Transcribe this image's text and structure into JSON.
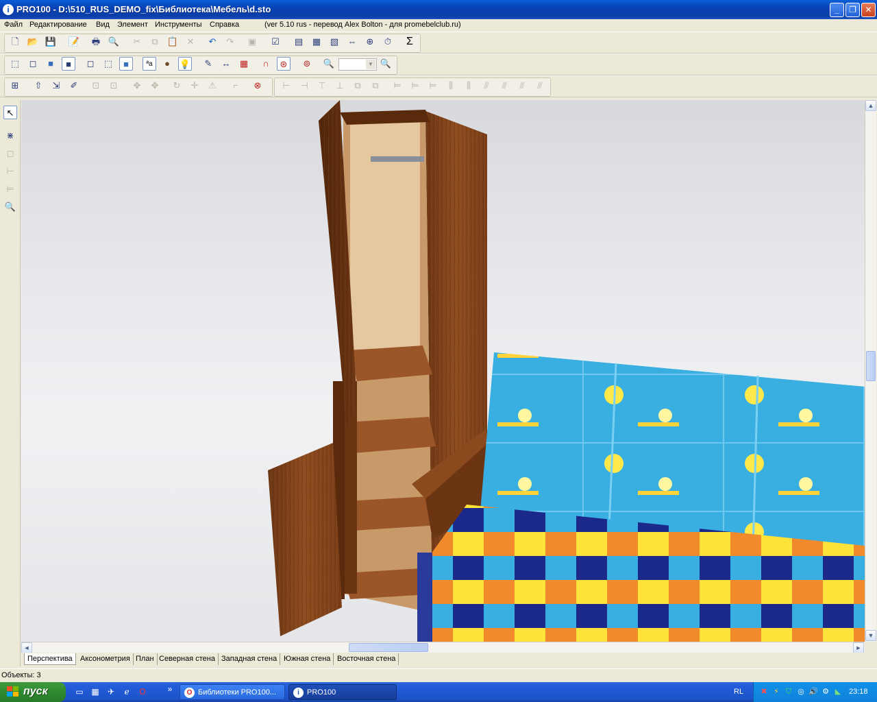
{
  "window": {
    "title": "PRO100 - D:\\510_RUS_DEMO_fix\\Библиотека\\Мебель\\d.sto",
    "app_icon": "PRO100-icon",
    "min_symbol": "_",
    "max_symbol": "❐",
    "close_symbol": "✕"
  },
  "menu": {
    "items": [
      "Файл",
      "Редактирование",
      "Вид",
      "Элемент",
      "Инструменты",
      "Справка"
    ],
    "version_note": "(ver 5.10 rus - перевод Alex Bolton - для promebelclub.ru)"
  },
  "toolbar1": {
    "icons": [
      "new-icon",
      "open-icon",
      "save-icon",
      "properties-icon",
      "print-icon",
      "print-preview-icon",
      "cut-icon",
      "copy-icon",
      "paste-icon",
      "delete-icon",
      "undo-icon",
      "redo-icon",
      "group-icon",
      "list-icon",
      "report-icon",
      "cutlist-icon",
      "cost-icon",
      "export-icon",
      "price-icon",
      "sum-icon"
    ],
    "sum_glyph": "Σ"
  },
  "toolbar2": {
    "icons": [
      "wireframe-icon",
      "outline-icon",
      "solid-icon",
      "shaded-icon",
      "view-front-icon",
      "view-side-icon",
      "view-3d-icon",
      "texture-text-icon",
      "sphere-icon",
      "light-bulb-icon",
      "camera-icon",
      "dimension-icon",
      "grid-icon",
      "magnet-icon",
      "snap-icon",
      "target-icon",
      "zoom-icon",
      "zoom-out-icon"
    ],
    "texture_label": "ªa",
    "zoom_value": ""
  },
  "toolbar3": {
    "icons": [
      "select-all-icon",
      "move-up-icon",
      "move-icon",
      "rotate-icon",
      "align-group-icon",
      "align-group2-icon",
      "arrow-up-icon",
      "arrow-down-icon",
      "rotate-cw-icon",
      "move-cross-icon",
      "mirror-icon",
      "corner-icon",
      "stop-icon",
      "align-left-icon",
      "align-center-icon",
      "align-right-icon",
      "align-top-icon",
      "align-middle-icon",
      "align-bottom-icon",
      "distribute-icon",
      "distribute2-icon",
      "distribute3-icon",
      "distribute4-icon",
      "distribute5-icon",
      "distribute6-icon",
      "distribute7-icon"
    ]
  },
  "left_toolbar": {
    "icons": [
      "pointer-icon",
      "scale-icon",
      "box-icon",
      "dimension-tool-icon",
      "align-tool-icon",
      "zoom-tool-icon"
    ]
  },
  "tabs": [
    "Перспектива",
    "Аксонометрия",
    "План",
    "Северная стена",
    "Западная стена",
    "Южная стена",
    "Восточная стена"
  ],
  "active_tab": 0,
  "status": {
    "objects_text": "Объекты: 3"
  },
  "scroll": {
    "up": "▲",
    "down": "▼",
    "left": "◄",
    "right": "►"
  },
  "taskbar": {
    "start_label": "пуск",
    "tasks": [
      {
        "label": "Библиотеки PRO100...",
        "icon": "opera-icon"
      },
      {
        "label": "PRO100",
        "icon": "PRO100-icon"
      }
    ],
    "language": "RL",
    "clock": "23:18",
    "chevron": "»"
  },
  "colors": {
    "wood": "#8a4a1e",
    "sofa_back": "#3fb6e6",
    "taskbar": "#245edb",
    "start": "#2f8a2f"
  }
}
